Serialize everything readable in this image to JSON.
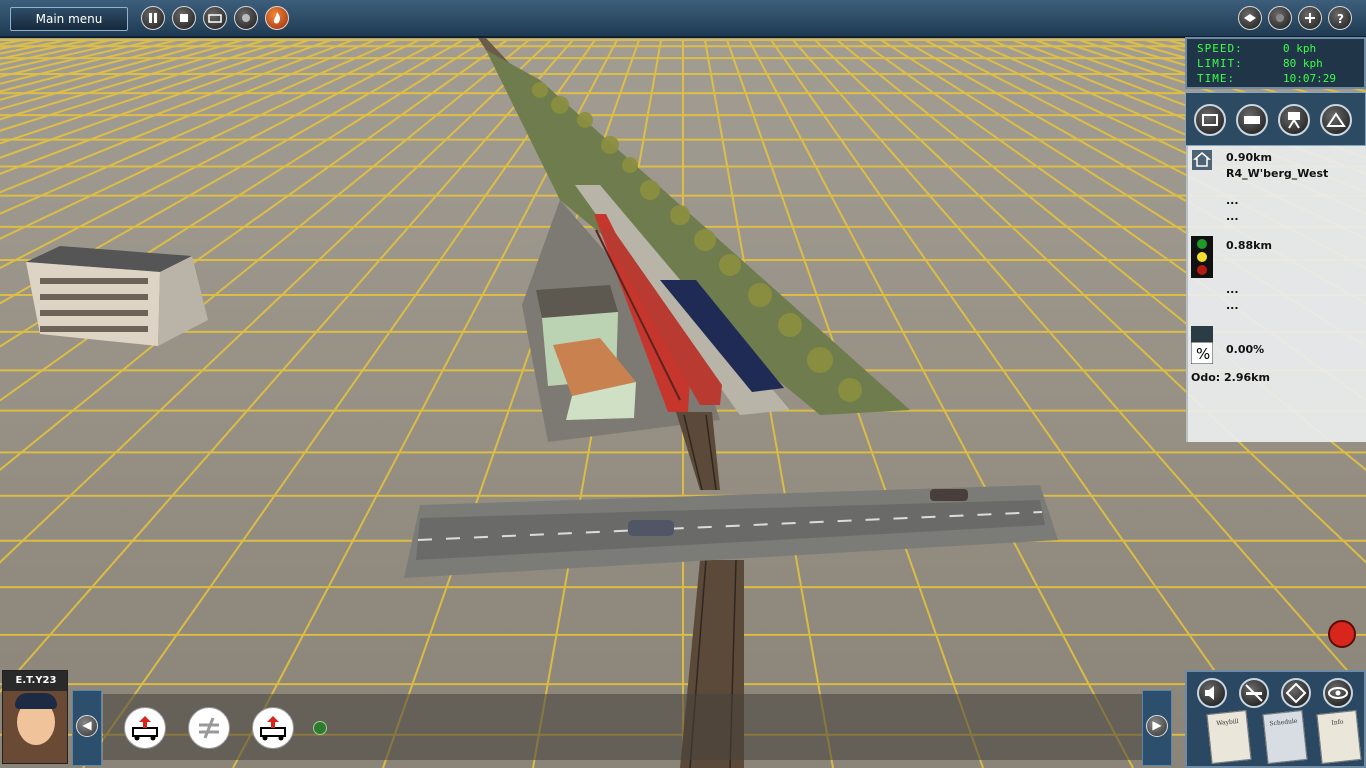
{
  "topbar": {
    "main_menu_label": "Main menu",
    "left_buttons": [
      "pause-icon",
      "stop-icon",
      "keyboard-icon",
      "record-icon",
      "flame-icon"
    ],
    "right_buttons": [
      "layers-icon",
      "sphere-icon",
      "add-icon",
      "help-icon"
    ]
  },
  "hud": {
    "speed_label": "SPEED:",
    "speed_value": "0 kph",
    "limit_label": "LIMIT:",
    "limit_value": "80 kph",
    "time_label": "TIME:",
    "time_value": "10:07:29",
    "text_color": "#3bff48"
  },
  "camera_buttons": [
    "cab-camera-icon",
    "external-camera-icon",
    "tripod-camera-icon",
    "free-camera-icon"
  ],
  "info_panel": {
    "station_distance": "0.90km",
    "station_name": "R4_W'berg_West",
    "station_dots_1": "...",
    "station_dots_2": "...",
    "signal_distance": "0.88km",
    "signal_dots_1": "...",
    "signal_dots_2": "...",
    "grade_value": "0.00%",
    "odometer": "Odo: 2.96km"
  },
  "bottom_tools": [
    "decouple-icon",
    "junction-switch-icon",
    "decouple-icon"
  ],
  "bottom_right": {
    "buttons": [
      "sound-icon",
      "no-smoke-icon",
      "diamond-icon",
      "eye-icon"
    ],
    "papers": [
      "Waybill",
      "Schedule",
      "Info"
    ]
  },
  "avatar": {
    "label": "E.T.Y23"
  },
  "colors": {
    "ground": "#8f8a80",
    "grid": "#e4c437",
    "topbar": "#2b4862",
    "accent_red": "#d9261c"
  }
}
